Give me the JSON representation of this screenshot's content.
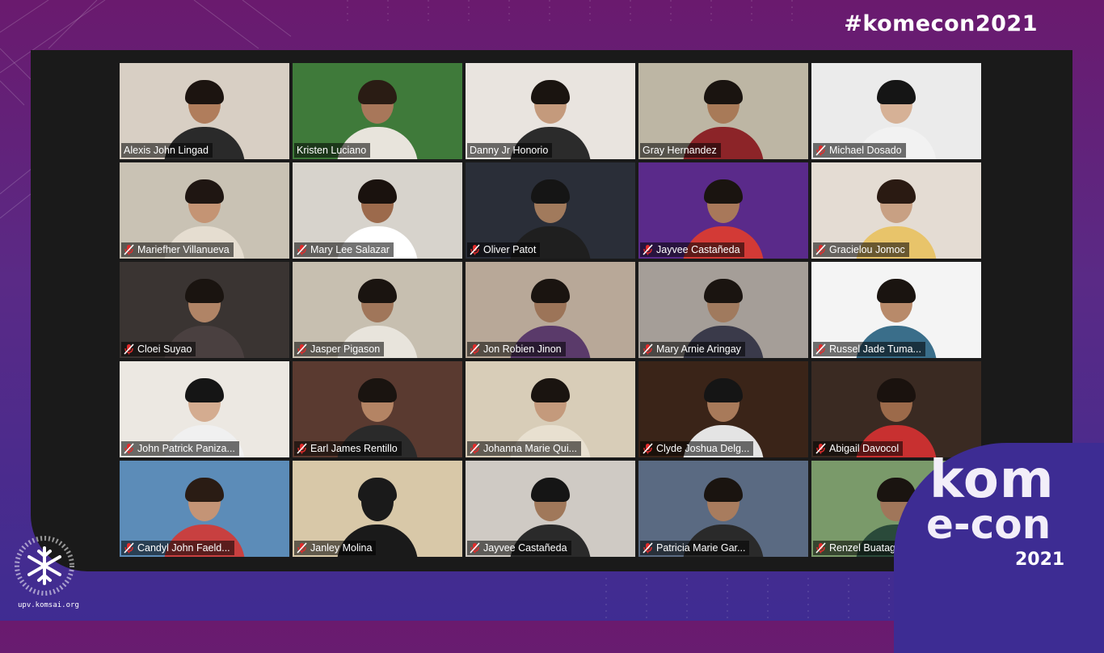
{
  "event": {
    "hashtag": "#komecon2021",
    "logo_line1": "kom",
    "logo_line2": "e-con",
    "logo_year": "2021",
    "org_url": "upv.komsai.org"
  },
  "colors": {
    "active_speaker_border": "#e8f75a",
    "muted_icon": "#e02b2b",
    "background_top": "#6a1a6e",
    "background_bottom": "#3f2c92"
  },
  "participants": [
    {
      "name": "Alexis John Lingad",
      "muted": false,
      "active": true,
      "bg": "#d8cfc4",
      "skin": "#b07d5c",
      "hair": "#1c1410",
      "shirt": "#2a2a2a"
    },
    {
      "name": "Kristen Luciano",
      "muted": false,
      "active": false,
      "bg": "#3f7a3a",
      "skin": "#a8775a",
      "hair": "#2a1c14",
      "shirt": "#e8e4dc"
    },
    {
      "name": "Danny Jr Honorio",
      "muted": false,
      "active": false,
      "bg": "#e9e4df",
      "skin": "#c49a7c",
      "hair": "#1a1410",
      "shirt": "#2b2b2b"
    },
    {
      "name": "Gray Hernandez",
      "muted": false,
      "active": false,
      "bg": "#bdb6a4",
      "skin": "#a87a58",
      "hair": "#1a1410",
      "shirt": "#8c2428"
    },
    {
      "name": "Michael Dosado",
      "muted": true,
      "active": false,
      "bg": "#ebebeb",
      "skin": "#d6b196",
      "hair": "#151515",
      "shirt": "#f2f2f2"
    },
    {
      "name": "Mariefher Villanueva",
      "muted": true,
      "active": false,
      "bg": "#c9c2b4",
      "skin": "#c49474",
      "hair": "#1f1612",
      "shirt": "#e5ddd0"
    },
    {
      "name": "Mary Lee Salazar",
      "muted": true,
      "active": false,
      "bg": "#d7d3cc",
      "skin": "#9c6a4c",
      "hair": "#1a120e",
      "shirt": "#ffffff"
    },
    {
      "name": "Oliver Patot",
      "muted": true,
      "active": false,
      "bg": "#2a2e38",
      "skin": "#a17a5c",
      "hair": "#151515",
      "shirt": "#1f1f1f"
    },
    {
      "name": "Jayvee Castañeda",
      "muted": true,
      "active": false,
      "bg": "#5a2a8a",
      "skin": "#a8785a",
      "hair": "#1a1410",
      "shirt": "#d33a36"
    },
    {
      "name": "Gracielou Jomoc",
      "muted": true,
      "active": false,
      "bg": "#e4dcd3",
      "skin": "#c8a083",
      "hair": "#2a1a12",
      "shirt": "#e8c46a"
    },
    {
      "name": "Cloei Suyao",
      "muted": true,
      "active": false,
      "bg": "#3a3432",
      "skin": "#b08466",
      "hair": "#1a1410",
      "shirt": "#4a4040"
    },
    {
      "name": "Jasper Pigason",
      "muted": true,
      "active": false,
      "bg": "#c7bfb0",
      "skin": "#a0765a",
      "hair": "#1a1410",
      "shirt": "#e8e4dc"
    },
    {
      "name": "Jon Robien Jinon",
      "muted": true,
      "active": false,
      "bg": "#b8a898",
      "skin": "#9c7458",
      "hair": "#1a1410",
      "shirt": "#5a3a6a"
    },
    {
      "name": "Mary Arnie Aringay",
      "muted": true,
      "active": false,
      "bg": "#a59e98",
      "skin": "#a07a5e",
      "hair": "#1a1410",
      "shirt": "#3a3a4a"
    },
    {
      "name": "Russel Jade Tuma...",
      "muted": true,
      "active": false,
      "bg": "#f4f4f4",
      "skin": "#b88a6a",
      "hair": "#1a1410",
      "shirt": "#3a6e8a"
    },
    {
      "name": "John Patrick Paniza...",
      "muted": true,
      "active": false,
      "bg": "#ece8e2",
      "skin": "#d4ac90",
      "hair": "#151515",
      "shirt": "#f0f0f0"
    },
    {
      "name": "Earl James Rentillo",
      "muted": true,
      "active": false,
      "bg": "#5a3a30",
      "skin": "#b48464",
      "hair": "#1a1410",
      "shirt": "#2a2a2a"
    },
    {
      "name": "Johanna Marie Qui...",
      "muted": true,
      "active": false,
      "bg": "#d8cdb8",
      "skin": "#c49a7c",
      "hair": "#1a1410",
      "shirt": "#e8e0d0"
    },
    {
      "name": "Clyde Joshua Delg...",
      "muted": true,
      "active": false,
      "bg": "#3a2418",
      "skin": "#a87a5a",
      "hair": "#151515",
      "shirt": "#e4e4e4"
    },
    {
      "name": "Abigail Davocol",
      "muted": true,
      "active": false,
      "bg": "#3a2a22",
      "skin": "#9c6a4a",
      "hair": "#1a120e",
      "shirt": "#c83030"
    },
    {
      "name": "Candyl John Faeld...",
      "muted": true,
      "active": false,
      "bg": "#5c8cb8",
      "skin": "#c49476",
      "hair": "#2a1c14",
      "shirt": "#c84040"
    },
    {
      "name": "Janley Molina",
      "muted": true,
      "active": false,
      "bg": "#d8c8a8",
      "skin": "#1a1a1a",
      "hair": "#1a1a1a",
      "shirt": "#1a1a1a"
    },
    {
      "name": "Jayvee Castañeda",
      "muted": true,
      "active": false,
      "bg": "#cfcac4",
      "skin": "#a0785a",
      "hair": "#151515",
      "shirt": "#2a2a2a"
    },
    {
      "name": "Patricia Marie Gar...",
      "muted": true,
      "active": false,
      "bg": "#5a6a82",
      "skin": "#a87c5e",
      "hair": "#1a1410",
      "shirt": "#2a2a2a"
    },
    {
      "name": "Renzel Buatag",
      "muted": true,
      "active": false,
      "bg": "#7a9a6a",
      "skin": "#a0765a",
      "hair": "#1a1410",
      "shirt": "#2a4a3a"
    }
  ]
}
